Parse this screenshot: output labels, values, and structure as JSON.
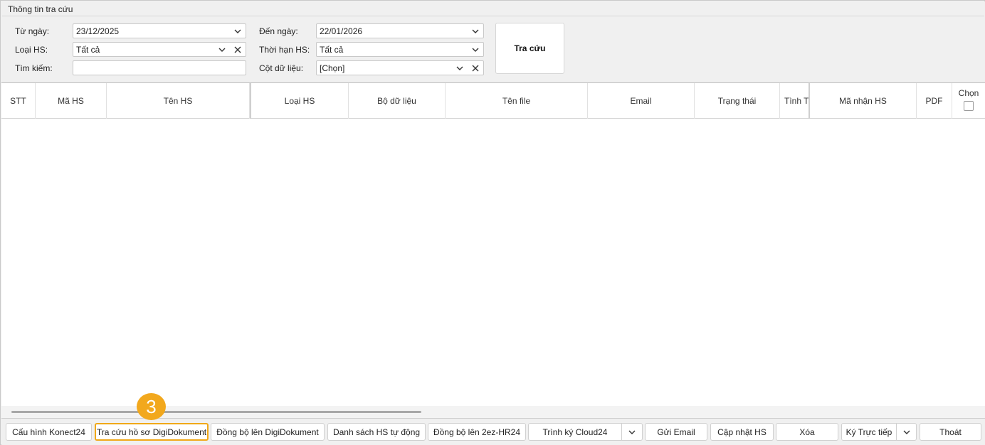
{
  "panel": {
    "title": "Thông tin tra cứu",
    "from_date_label": "Từ ngày:",
    "from_date_value": "23/12/2025",
    "to_date_label": "Đến ngày:",
    "to_date_value": "22/01/2026",
    "type_label": "Loại HS:",
    "type_value": "Tất cả",
    "term_label": "Thời hạn HS:",
    "term_value": "Tất cả",
    "search_label": "Tìm kiếm:",
    "search_value": "",
    "column_label": "Cột dữ liệu:",
    "column_value": "[Chọn]",
    "search_button": "Tra cứu"
  },
  "grid": {
    "columns": [
      "STT",
      "Mã HS",
      "Tên HS",
      "Loại HS",
      "Bộ dữ liệu",
      "Tên file",
      "Email",
      "Trạng thái",
      "Tình Tr",
      "Mã nhận HS",
      "PDF",
      "Chọn"
    ]
  },
  "toolbar": {
    "buttons": [
      "Cấu hình Konect24",
      "Tra cứu hồ sơ DigiDokument",
      "Đồng bộ lên DigiDokument",
      "Danh sách HS tự động",
      "Đồng bộ lên 2ez-HR24",
      "Trình ký Cloud24",
      "Gửi Email",
      "Cập nhật HS",
      "Xóa",
      "Ký Trực tiếp",
      "Thoát"
    ]
  },
  "annotation": {
    "step": "3"
  },
  "colors": {
    "highlight": "#f0a818",
    "badge": "#f2a81d"
  }
}
